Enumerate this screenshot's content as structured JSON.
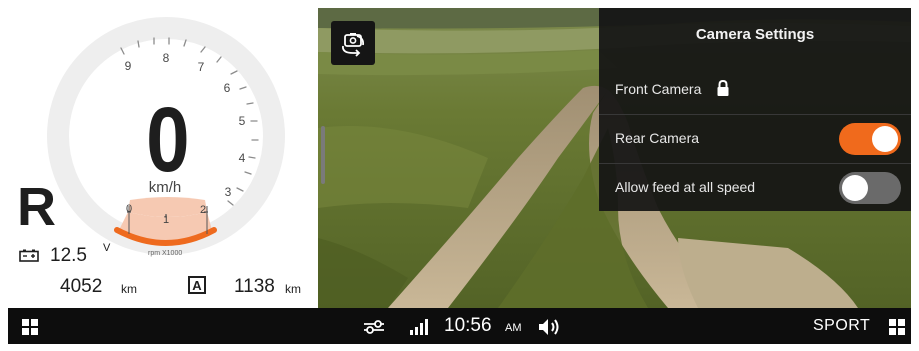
{
  "gauge": {
    "dial_numbers": [
      "9",
      "8",
      "7",
      "6",
      "5",
      "4",
      "3"
    ],
    "speed": "0",
    "speed_unit": "km/h",
    "rpm_numbers": [
      "0",
      "1",
      "2"
    ],
    "rpm_note": "rpm X1000",
    "gear": "R",
    "battery_value": "12.5",
    "battery_unit": "V",
    "odometer_value": "4052",
    "odometer_unit": "km",
    "trip_label": "A",
    "trip_value": "1138",
    "trip_unit": "km",
    "colors": {
      "rpm_fill": "#f6c9b2",
      "rpm_arc": "#ee6a1e",
      "text": "#1e1e1e"
    }
  },
  "camera": {
    "switch_icon": "camera-rotate-icon"
  },
  "settings": {
    "title": "Camera Settings",
    "rows": [
      {
        "label": "Front Camera",
        "icon": "lock-icon",
        "locked": true
      },
      {
        "label": "Rear Camera",
        "toggle": "on"
      },
      {
        "label": "Allow feed at all speed",
        "toggle": "off"
      }
    ],
    "colors": {
      "toggle_on": "#f06a1c",
      "toggle_off": "#6a6a6a"
    }
  },
  "bottom_bar": {
    "left_icon": "grid-icon",
    "status_icons": [
      "tune-icon",
      "signal-icon",
      "volume-icon"
    ],
    "time": "10:56",
    "ampm": "AM",
    "drive_mode": "SPORT",
    "right_icon": "grid-icon"
  }
}
